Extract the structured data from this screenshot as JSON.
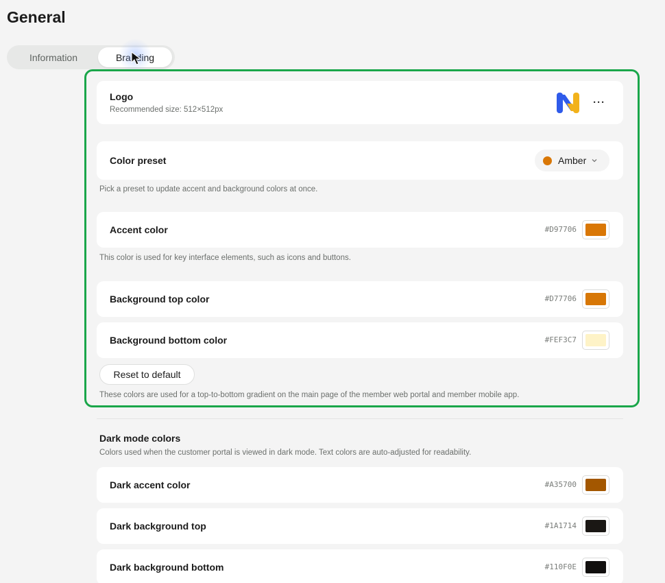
{
  "page": {
    "title": "General"
  },
  "tabs": [
    {
      "label": "Information",
      "active": false
    },
    {
      "label": "Branding",
      "active": true
    }
  ],
  "branding": {
    "logo": {
      "label": "Logo",
      "sublabel": "Recommended size: 512×512px",
      "more_icon": "ellipsis-icon"
    },
    "color_preset": {
      "label": "Color preset",
      "selected": "Amber",
      "selected_color": "#D97706",
      "hint": "Pick a preset to update accent and background colors at once."
    },
    "accent_color": {
      "label": "Accent color",
      "hex": "#D97706",
      "hint": "This color is used for key interface elements, such as icons and buttons."
    },
    "background_top": {
      "label": "Background top color",
      "hex": "#D77706"
    },
    "background_bottom": {
      "label": "Background bottom color",
      "hex": "#FEF3C7"
    },
    "reset_label": "Reset to default",
    "gradient_hint": "These colors are used for a top-to-bottom gradient on the main page of the member web portal and member mobile app."
  },
  "dark_mode": {
    "title": "Dark mode colors",
    "subtitle": "Colors used when the customer portal is viewed in dark mode. Text colors are auto-adjusted for readability.",
    "accent": {
      "label": "Dark accent color",
      "hex": "#A35700"
    },
    "background_top": {
      "label": "Dark background top",
      "hex": "#1A1714"
    },
    "background_bottom": {
      "label": "Dark background bottom",
      "hex": "#110F0E"
    }
  },
  "colors": {
    "highlight_border": "#1AA64A",
    "logo_blue": "#2F5BEA",
    "logo_yellow": "#F2B21B"
  }
}
